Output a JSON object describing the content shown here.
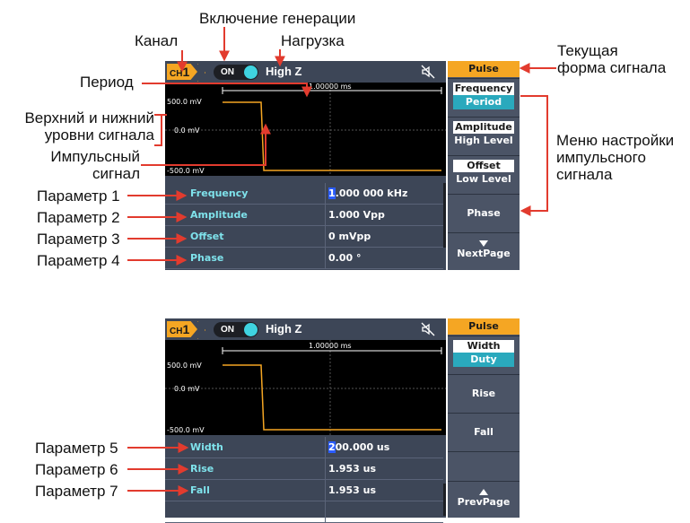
{
  "annotations": {
    "enable": "Включение генерации",
    "channel": "Канал",
    "load": "Нагрузка",
    "current_wave_1": "Текущая",
    "current_wave_2": "форма сигнала",
    "period": "Период",
    "levels_1": "Верхний и нижний",
    "levels_2": "уровни сигнала",
    "pulse_1": "Импульсный",
    "pulse_2": "сигнал",
    "menu_1": "Меню настройки",
    "menu_2": "импульсного",
    "menu_3": "сигнала",
    "param1": "Параметр 1",
    "param2": "Параметр 2",
    "param3": "Параметр 3",
    "param4": "Параметр 4",
    "param5": "Параметр 5",
    "param6": "Параметр 6",
    "param7": "Параметр 7"
  },
  "screen1": {
    "channel": "CH",
    "channel_num": "1",
    "output_state": "ON",
    "load": "High Z",
    "period_label": "1.00000 ms",
    "level_high": "500.0 mV",
    "level_mid": "0.0 mV",
    "level_low": "-500.0 mV",
    "params": [
      {
        "name": "Frequency",
        "value_cursor": "1",
        "value_rest": ".000 000 kHz"
      },
      {
        "name": "Amplitude",
        "value_cursor": "",
        "value_rest": "1.000 Vpp"
      },
      {
        "name": "Offset",
        "value_cursor": "",
        "value_rest": "0 mVpp"
      },
      {
        "name": "Phase",
        "value_cursor": "",
        "value_rest": "0.00 °"
      }
    ],
    "menu": {
      "title": "Pulse",
      "items": [
        {
          "a": "Frequency",
          "b": "Period"
        },
        {
          "a": "Amplitude",
          "b": "High Level"
        },
        {
          "a": "Offset",
          "b": "Low Level"
        },
        {
          "s": "Phase"
        },
        {
          "s": "NextPage"
        }
      ]
    }
  },
  "screen2": {
    "channel": "CH",
    "channel_num": "1",
    "output_state": "ON",
    "load": "High Z",
    "period_label": "1.00000 ms",
    "level_high": "500.0 mV",
    "level_mid": "0.0 mV",
    "level_low": "-500.0 mV",
    "params": [
      {
        "name": "Width",
        "value_cursor": "2",
        "value_rest": "00.000 us"
      },
      {
        "name": "Rise",
        "value_cursor": "",
        "value_rest": "1.953 us"
      },
      {
        "name": "Fall",
        "value_cursor": "",
        "value_rest": "1.953 us"
      }
    ],
    "menu": {
      "title": "Pulse",
      "items": [
        {
          "a": "Width",
          "b": "Duty"
        },
        {
          "s": "Rise"
        },
        {
          "s": "Fall"
        },
        {
          "s": ""
        },
        {
          "s": "PrevPage"
        }
      ]
    }
  },
  "colors": {
    "accent": "#f5a623",
    "screen_bg": "#3d4657",
    "param_name": "#7fe3ec",
    "arrow": "#e23b2e",
    "toggle_knob": "#3fd3e0"
  }
}
